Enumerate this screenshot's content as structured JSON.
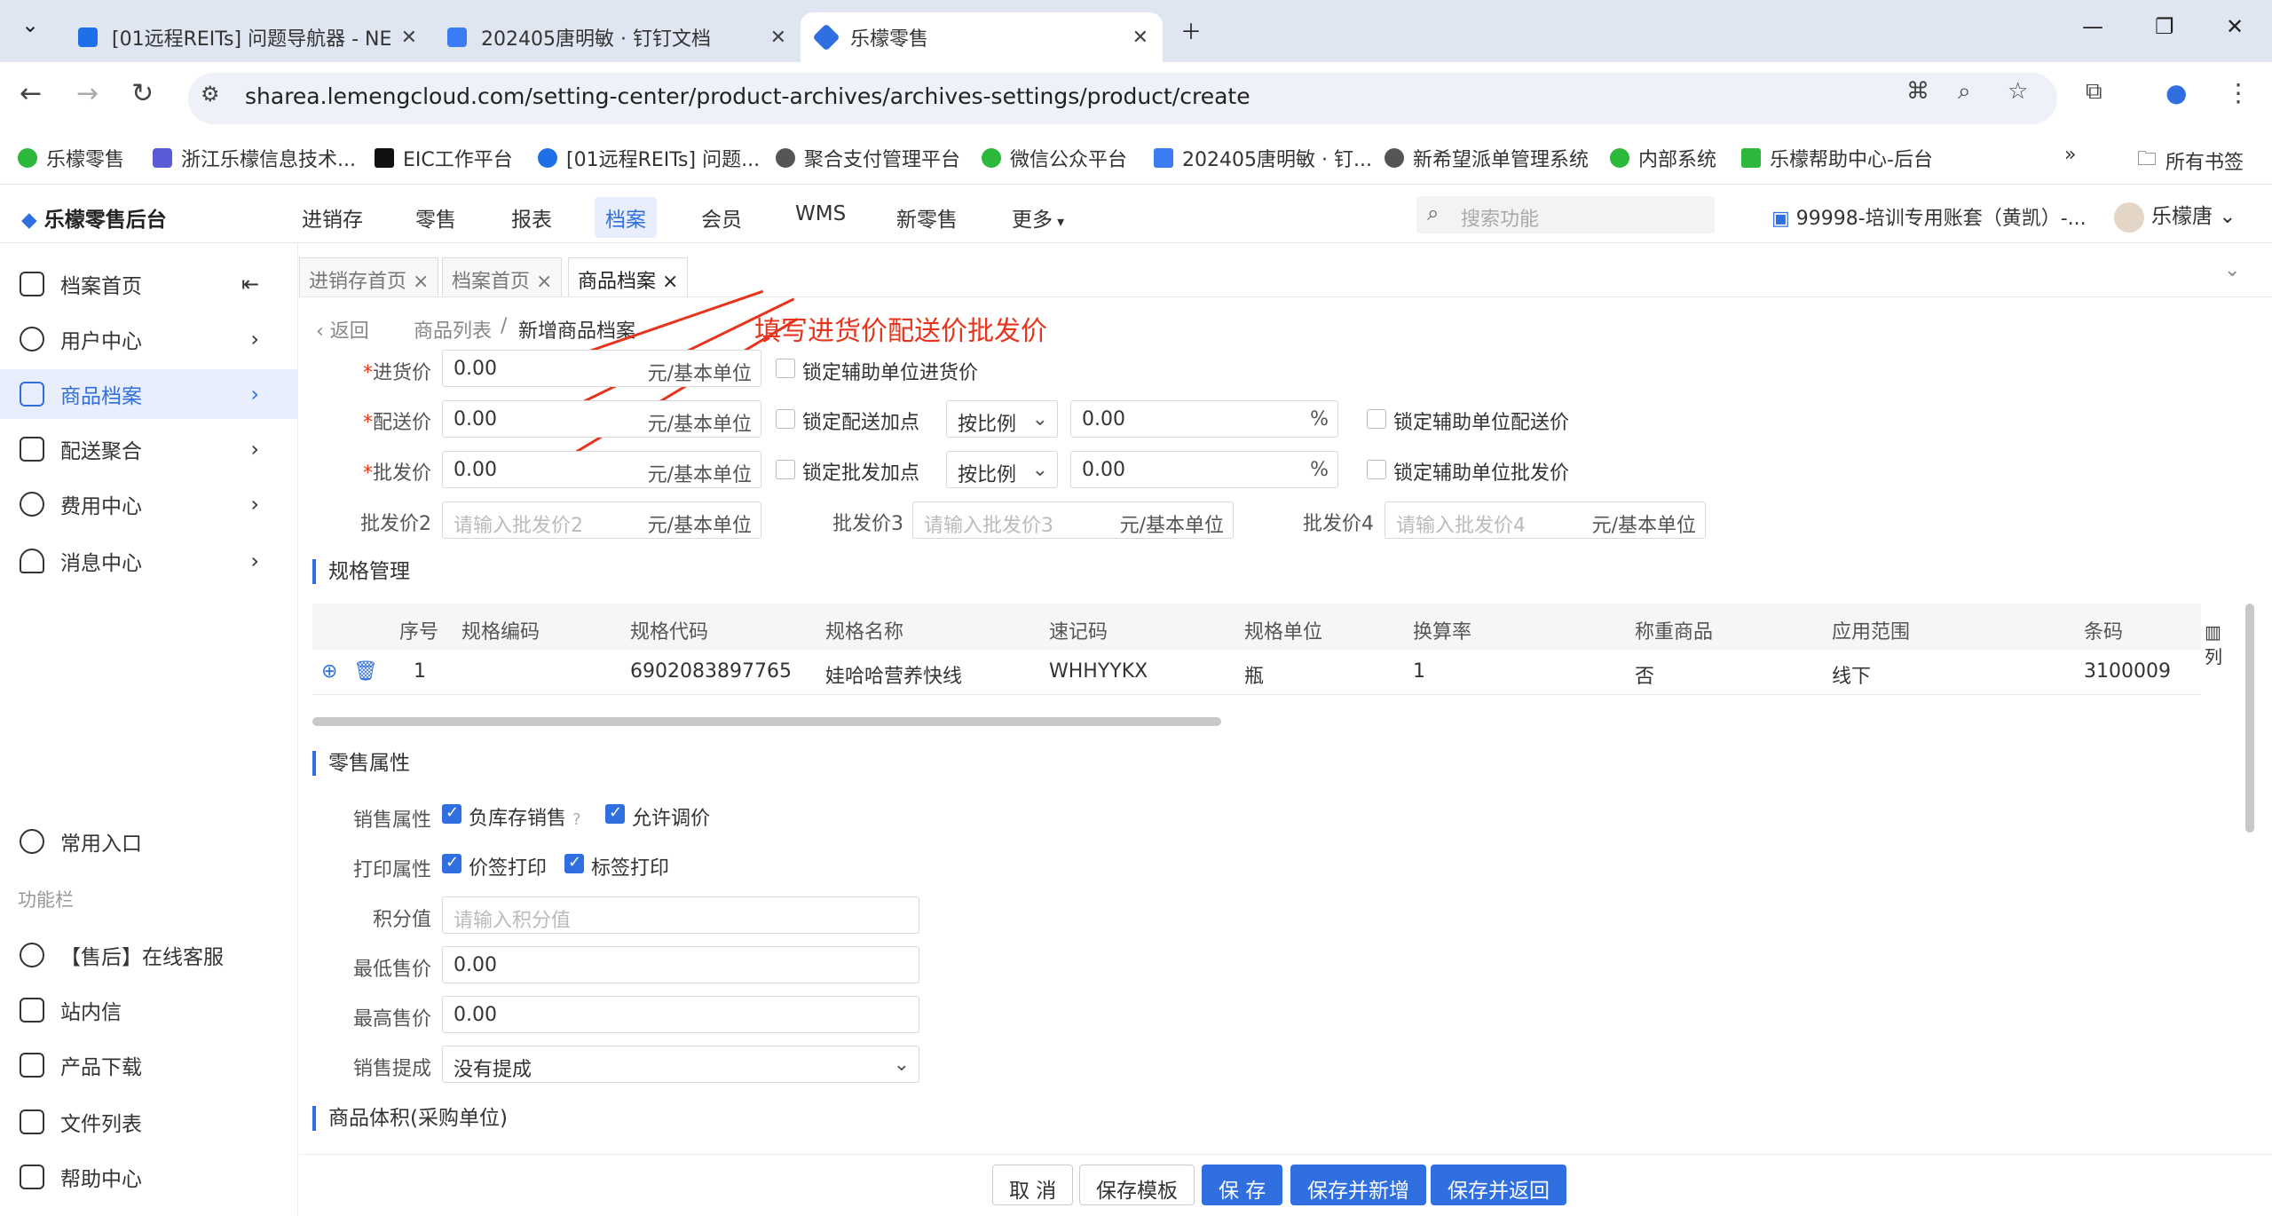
{
  "browser": {
    "tabs": [
      {
        "title": "[01远程REITs] 问题导航器 - NE"
      },
      {
        "title": "202405唐明敏 · 钉钉文档"
      },
      {
        "title": "乐檬零售"
      }
    ],
    "url": "sharea.lemengcloud.com/setting-center/product-archives/archives-settings/product/create",
    "bookmarks": [
      "乐檬零售",
      "浙江乐檬信息技术...",
      "EIC工作平台",
      "[01远程REITs] 问题...",
      "聚合支付管理平台",
      "微信公众平台",
      "202405唐明敏 · 钉...",
      "新希望派单管理系统",
      "内部系统",
      "乐檬帮助中心-后台"
    ],
    "all_bookmarks": "所有书签"
  },
  "app": {
    "logo": "乐檬零售后台",
    "nav": [
      "进销存",
      "零售",
      "报表",
      "档案",
      "会员",
      "WMS",
      "新零售",
      "更多"
    ],
    "search_placeholder": "搜索功能",
    "account": "99998-培训专用账套（黄凯）-...",
    "user": "乐檬唐"
  },
  "sidebar": {
    "items": [
      {
        "label": "档案首页"
      },
      {
        "label": "用户中心"
      },
      {
        "label": "商品档案"
      },
      {
        "label": "配送聚合"
      },
      {
        "label": "费用中心"
      },
      {
        "label": "消息中心"
      }
    ],
    "common": "常用入口",
    "func_title": "功能栏",
    "func": [
      "【售后】在线客服",
      "站内信",
      "产品下载",
      "文件列表",
      "帮助中心"
    ]
  },
  "page_tabs": [
    "进销存首页",
    "档案首页",
    "商品档案"
  ],
  "breadcrumb": {
    "back": "返回",
    "list": "商品列表",
    "sep": "/",
    "current": "新增商品档案"
  },
  "annotation": "填写进货价配送价批发价",
  "prices": {
    "purchase": {
      "label": "进货价",
      "value": "0.00",
      "unit": "元/基本单位",
      "lock": "锁定辅助单位进货价"
    },
    "delivery": {
      "label": "配送价",
      "value": "0.00",
      "unit": "元/基本单位",
      "lock_add": "锁定配送加点",
      "mode": "按比例",
      "pct": "0.00",
      "pct_unit": "%",
      "lock_aux": "锁定辅助单位配送价"
    },
    "wholesale": {
      "label": "批发价",
      "value": "0.00",
      "unit": "元/基本单位",
      "lock_add": "锁定批发加点",
      "mode": "按比例",
      "pct": "0.00",
      "pct_unit": "%",
      "lock_aux": "锁定辅助单位批发价"
    },
    "w2": {
      "label": "批发价2",
      "placeholder": "请输入批发价2",
      "unit": "元/基本单位"
    },
    "w3": {
      "label": "批发价3",
      "placeholder": "请输入批发价3",
      "unit": "元/基本单位"
    },
    "w4": {
      "label": "批发价4",
      "placeholder": "请输入批发价4",
      "unit": "元/基本单位"
    }
  },
  "spec": {
    "title": "规格管理",
    "headers": [
      "序号",
      "规格编码",
      "规格代码",
      "规格名称",
      "速记码",
      "规格单位",
      "换算率",
      "称重商品",
      "应用范围",
      "条码"
    ],
    "row": [
      "1",
      "",
      "6902083897765",
      "娃哈哈营养快线",
      "WHHYYKX",
      "瓶",
      "1",
      "否",
      "线下",
      "3100009"
    ],
    "col_btn": "列"
  },
  "retail": {
    "title": "零售属性",
    "sale_label": "销售属性",
    "neg_stock": "负库存销售",
    "allow_adjust": "允许调价",
    "print_label": "打印属性",
    "price_tag": "价签打印",
    "label_print": "标签打印",
    "points_label": "积分值",
    "points_placeholder": "请输入积分值",
    "min_label": "最低售价",
    "min_value": "0.00",
    "max_label": "最高售价",
    "max_value": "0.00",
    "comm_label": "销售提成",
    "comm_value": "没有提成"
  },
  "volume_title": "商品体积(采购单位)",
  "footer": {
    "cancel": "取 消",
    "save_tpl": "保存模板",
    "save": "保 存",
    "save_new": "保存并新增",
    "save_back": "保存并返回"
  },
  "colors": {
    "primary": "#2f6fe0",
    "annotation": "#e8341c"
  }
}
